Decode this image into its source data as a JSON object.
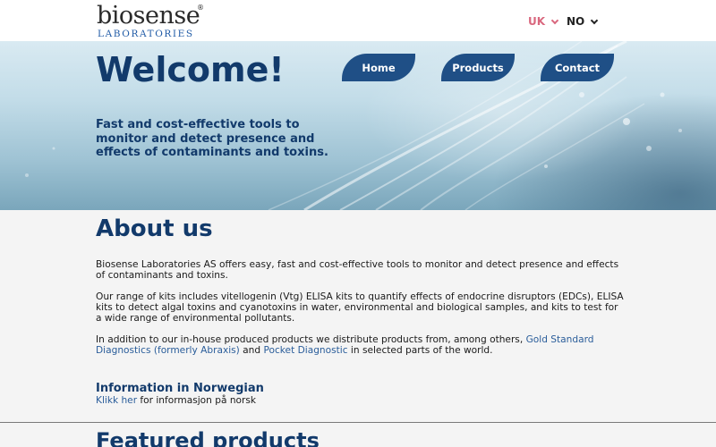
{
  "header": {
    "logo": {
      "main": "biosense",
      "sub": "LABORATORIES",
      "reg": "®"
    },
    "languages": [
      {
        "label": "UK",
        "active": true
      },
      {
        "label": "NO",
        "active": false
      }
    ]
  },
  "hero": {
    "title": "Welcome!",
    "tagline": "Fast and cost-effective tools to monitor and detect presence and effects of contaminants and toxins.",
    "nav": [
      {
        "label": "Home"
      },
      {
        "label": "Products"
      },
      {
        "label": "Contact"
      }
    ]
  },
  "about": {
    "title": "About us",
    "p1": "Biosense Laboratories AS offers easy, fast and cost-effective tools to monitor and detect presence and effects of contaminants and toxins.",
    "p2": "Our range of kits includes vitellogenin (Vtg) ELISA kits to quantify effects of endocrine disruptors (EDCs), ELISA kits to detect algal toxins and cyanotoxins in water, environmental and biological samples, and kits to test for a wide range of environmental pollutants.",
    "p3_pre": "In addition to our in-house produced products we distribute products from, among others, ",
    "p3_link1": "Gold Standard Diagnostics (formerly Abraxis)",
    "p3_mid": " and ",
    "p3_link2": "Pocket Diagnostic",
    "p3_post": "  in selected parts of the world."
  },
  "info": {
    "title": "Information in Norwegian",
    "link": "Klikk her",
    "text": " for informasjon på norsk"
  },
  "featured": {
    "title": "Featured products"
  },
  "colors": {
    "brand_dark": "#123a6b",
    "nav_button": "#1f4f86",
    "lang_active": "#d9677e",
    "link": "#2a5d9a"
  }
}
